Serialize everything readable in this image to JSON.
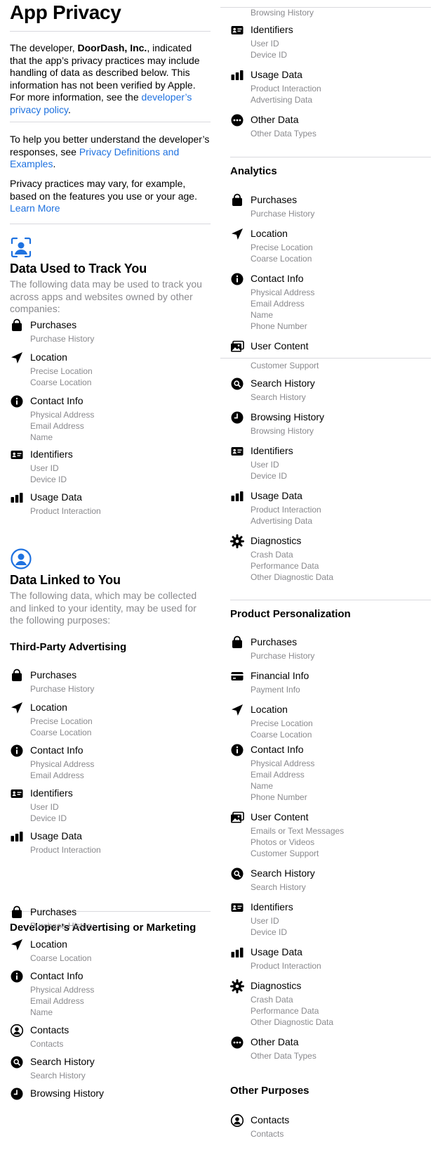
{
  "header": {
    "title": "App Privacy",
    "intro_prefix": "The developer, ",
    "developer": "DoorDash, Inc.",
    "intro_body": ", indicated that the app’s privacy practices may include handling of data as described below. This information has not been verified by Apple. For more information, see the ",
    "policy_link": "developer’s privacy policy",
    "intro_end": ".",
    "help_prefix": "To help you better understand the developer’s responses, see ",
    "help_link": "Privacy Definitions and Examples",
    "help_end": ".",
    "vary_text": "Privacy practices may vary, for example, based on the features you use or your age. ",
    "learn_more": "Learn More"
  },
  "track": {
    "title": "Data Used to Track You",
    "desc": "The following data may be used to track you across apps and websites owned by other companies:",
    "cats": [
      {
        "label": "Purchases",
        "icon": "bag-icon",
        "items": [
          "Purchase History"
        ]
      },
      {
        "label": "Location",
        "icon": "location-arrow-icon",
        "items": [
          "Precise Location",
          "Coarse Location"
        ]
      },
      {
        "label": "Contact Info",
        "icon": "info-icon",
        "items": [
          "Physical Address",
          "Email Address",
          "Name"
        ]
      },
      {
        "label": "Identifiers",
        "icon": "id-card-icon",
        "items": [
          "User ID",
          "Device ID"
        ]
      },
      {
        "label": "Usage Data",
        "icon": "bar-chart-icon",
        "items": [
          "Product Interaction"
        ]
      }
    ]
  },
  "linked": {
    "title": "Data Linked to You",
    "desc": "The following data, which may be collected and linked to your identity, may be used for the following purposes:",
    "third_party": {
      "title": "Third-Party Advertising",
      "cats": [
        {
          "label": "Purchases",
          "icon": "bag-icon",
          "items": [
            "Purchase History"
          ]
        },
        {
          "label": "Location",
          "icon": "location-arrow-icon",
          "items": [
            "Precise Location",
            "Coarse Location"
          ]
        },
        {
          "label": "Contact Info",
          "icon": "info-icon",
          "items": [
            "Physical Address",
            "Email Address"
          ]
        },
        {
          "label": "Identifiers",
          "icon": "id-card-icon",
          "items": [
            "User ID",
            "Device ID"
          ]
        },
        {
          "label": "Usage Data",
          "icon": "bar-chart-icon",
          "items": [
            "Product Interaction"
          ]
        }
      ]
    },
    "dev_marketing": {
      "title": "Developer’s Advertising or Marketing",
      "cats": [
        {
          "label": "Purchases",
          "icon": "bag-icon",
          "items": [
            "Purchase History"
          ]
        },
        {
          "label": "Location",
          "icon": "location-arrow-icon",
          "items": [
            "Coarse Location"
          ]
        },
        {
          "label": "Contact Info",
          "icon": "info-icon",
          "items": [
            "Physical Address",
            "Email Address",
            "Name"
          ]
        },
        {
          "label": "Contacts",
          "icon": "person-circle-icon",
          "items": [
            "Contacts"
          ]
        },
        {
          "label": "Search History",
          "icon": "search-circle-icon",
          "items": [
            "Search History"
          ]
        },
        {
          "label": "Browsing History",
          "icon": "clock-icon",
          "items": []
        }
      ]
    }
  },
  "right": {
    "top_fragment": "Browsing History",
    "top_cats": [
      {
        "label": "Identifiers",
        "icon": "id-card-icon",
        "items": [
          "User ID",
          "Device ID"
        ]
      },
      {
        "label": "Usage Data",
        "icon": "bar-chart-icon",
        "items": [
          "Product Interaction",
          "Advertising Data"
        ]
      },
      {
        "label": "Other Data",
        "icon": "ellipsis-icon",
        "items": [
          "Other Data Types"
        ]
      }
    ],
    "analytics": {
      "title": "Analytics",
      "cats": [
        {
          "label": "Purchases",
          "icon": "bag-icon",
          "items": [
            "Purchase History"
          ]
        },
        {
          "label": "Location",
          "icon": "location-arrow-icon",
          "items": [
            "Precise Location",
            "Coarse Location"
          ]
        },
        {
          "label": "Contact Info",
          "icon": "info-icon",
          "items": [
            "Physical Address",
            "Email Address",
            "Name",
            "Phone Number"
          ]
        },
        {
          "label": "User Content",
          "icon": "photos-icon",
          "items": []
        }
      ],
      "fragment": "Customer Support",
      "cats2": [
        {
          "label": "Search History",
          "icon": "search-circle-icon",
          "items": [
            "Search History"
          ]
        },
        {
          "label": "Browsing History",
          "icon": "clock-icon",
          "items": [
            "Browsing History"
          ]
        },
        {
          "label": "Identifiers",
          "icon": "id-card-icon",
          "items": [
            "User ID",
            "Device ID"
          ]
        },
        {
          "label": "Usage Data",
          "icon": "bar-chart-icon",
          "items": [
            "Product Interaction",
            "Advertising Data"
          ]
        },
        {
          "label": "Diagnostics",
          "icon": "gear-icon",
          "items": [
            "Crash Data",
            "Performance Data",
            "Other Diagnostic Data"
          ]
        }
      ]
    },
    "personalization": {
      "title": "Product Personalization",
      "cats": [
        {
          "label": "Purchases",
          "icon": "bag-icon",
          "items": [
            "Purchase History"
          ]
        },
        {
          "label": "Financial Info",
          "icon": "credit-card-icon",
          "items": [
            "Payment Info"
          ]
        },
        {
          "label": "Location",
          "icon": "location-arrow-icon",
          "items": [
            "Precise Location",
            "Coarse Location"
          ]
        },
        {
          "label": "Contact Info",
          "icon": "info-icon",
          "items": [
            "Physical Address",
            "Email Address",
            "Name",
            "Phone Number"
          ]
        },
        {
          "label": "User Content",
          "icon": "photos-icon",
          "items": [
            "Emails or Text Messages",
            "Photos or Videos",
            "Customer Support"
          ]
        },
        {
          "label": "Search History",
          "icon": "search-circle-icon",
          "items": [
            "Search History"
          ]
        },
        {
          "label": "Identifiers",
          "icon": "id-card-icon",
          "items": [
            "User ID",
            "Device ID"
          ]
        },
        {
          "label": "Usage Data",
          "icon": "bar-chart-icon",
          "items": [
            "Product Interaction"
          ]
        },
        {
          "label": "Diagnostics",
          "icon": "gear-icon",
          "items": [
            "Crash Data",
            "Performance Data",
            "Other Diagnostic Data"
          ]
        },
        {
          "label": "Other Data",
          "icon": "ellipsis-icon",
          "items": [
            "Other Data Types"
          ]
        }
      ]
    },
    "other": {
      "title": "Other Purposes",
      "cats": [
        {
          "label": "Contacts",
          "icon": "person-circle-icon",
          "items": [
            "Contacts"
          ]
        }
      ]
    }
  },
  "colors": {
    "link": "#1f72e0",
    "secondary_text": "#8a8a8e",
    "accent_icon": "#1f72e0",
    "divider": "#d9d9de"
  }
}
